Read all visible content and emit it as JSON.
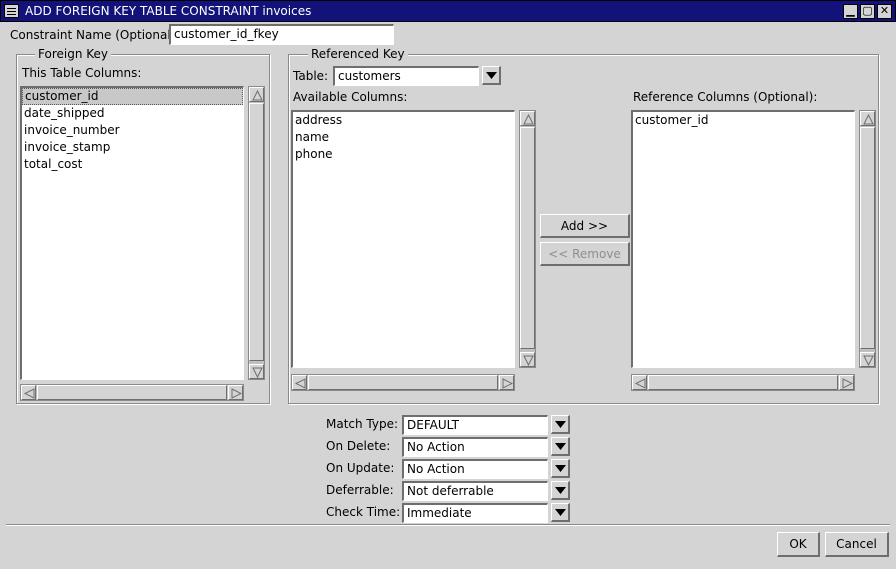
{
  "window": {
    "title": "ADD FOREIGN KEY TABLE CONSTRAINT invoices"
  },
  "constraint": {
    "label": "Constraint Name (Optional):",
    "value": "customer_id_fkey"
  },
  "foreign_key": {
    "group_title": "Foreign Key",
    "columns_label": "This Table Columns:",
    "columns": [
      "customer_id",
      "date_shipped",
      "invoice_number",
      "invoice_stamp",
      "total_cost"
    ],
    "selected_index": 0
  },
  "referenced_key": {
    "group_title": "Referenced Key",
    "table_label": "Table:",
    "table_value": "customers",
    "available_label": "Available Columns:",
    "available_columns": [
      "address",
      "name",
      "phone"
    ],
    "reference_label": "Reference Columns (Optional):",
    "reference_columns": [
      "customer_id"
    ],
    "add_label": "Add >>",
    "remove_label": "<< Remove"
  },
  "options": {
    "match_type": {
      "label": "Match Type:",
      "value": "DEFAULT"
    },
    "on_delete": {
      "label": "On Delete:",
      "value": "No Action"
    },
    "on_update": {
      "label": "On Update:",
      "value": "No Action"
    },
    "deferrable": {
      "label": "Deferrable:",
      "value": "Not deferrable"
    },
    "check_time": {
      "label": "Check Time:",
      "value": "Immediate"
    }
  },
  "footer": {
    "ok_label": "OK",
    "cancel_label": "Cancel"
  },
  "colors": {
    "titlebar": "#12127a",
    "background": "#d4d4d4",
    "selection": "#c8c8c8"
  }
}
